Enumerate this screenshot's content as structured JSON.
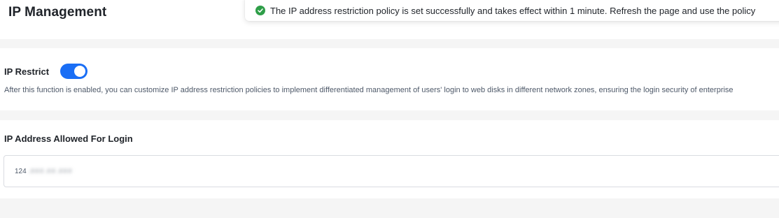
{
  "header": {
    "title": "IP Management"
  },
  "toast": {
    "icon": "check-circle-icon",
    "status_color": "#2e9e48",
    "message": "The IP address restriction policy is set successfully and takes effect within 1 minute. Refresh the page and use the policy"
  },
  "ip_restrict": {
    "label": "IP Restrict",
    "enabled": true,
    "toggle_color": "#1a6ef5",
    "description": "After this function is enabled, you can customize IP address restriction policies to implement differentiated management of users' login to web disks in different network zones, ensuring the login security of enterprise"
  },
  "allowed_ips": {
    "label": "IP Address Allowed For Login",
    "value_visible": "124",
    "value_masked": ".###.##.###"
  }
}
